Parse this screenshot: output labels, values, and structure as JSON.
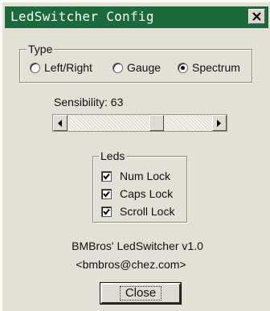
{
  "window": {
    "title": "LedSwitcher Config"
  },
  "type_group": {
    "legend": "Type",
    "options": [
      {
        "label": "Left/Right",
        "selected": false
      },
      {
        "label": "Gauge",
        "selected": false
      },
      {
        "label": "Spectrum",
        "selected": true
      }
    ]
  },
  "sensibility": {
    "label": "Sensibility: 63",
    "value": 63
  },
  "leds_group": {
    "legend": "Leds",
    "items": [
      {
        "label": "Num Lock",
        "checked": true
      },
      {
        "label": "Caps Lock",
        "checked": true
      },
      {
        "label": "Scroll Lock",
        "checked": true
      }
    ]
  },
  "about": {
    "name": "BMBros' LedSwitcher v1.0",
    "email": "<bmbros@chez.com>"
  },
  "buttons": {
    "close": "Close"
  },
  "colors": {
    "titlebar": "#1b6a3b",
    "face": "#e3e0d6"
  }
}
